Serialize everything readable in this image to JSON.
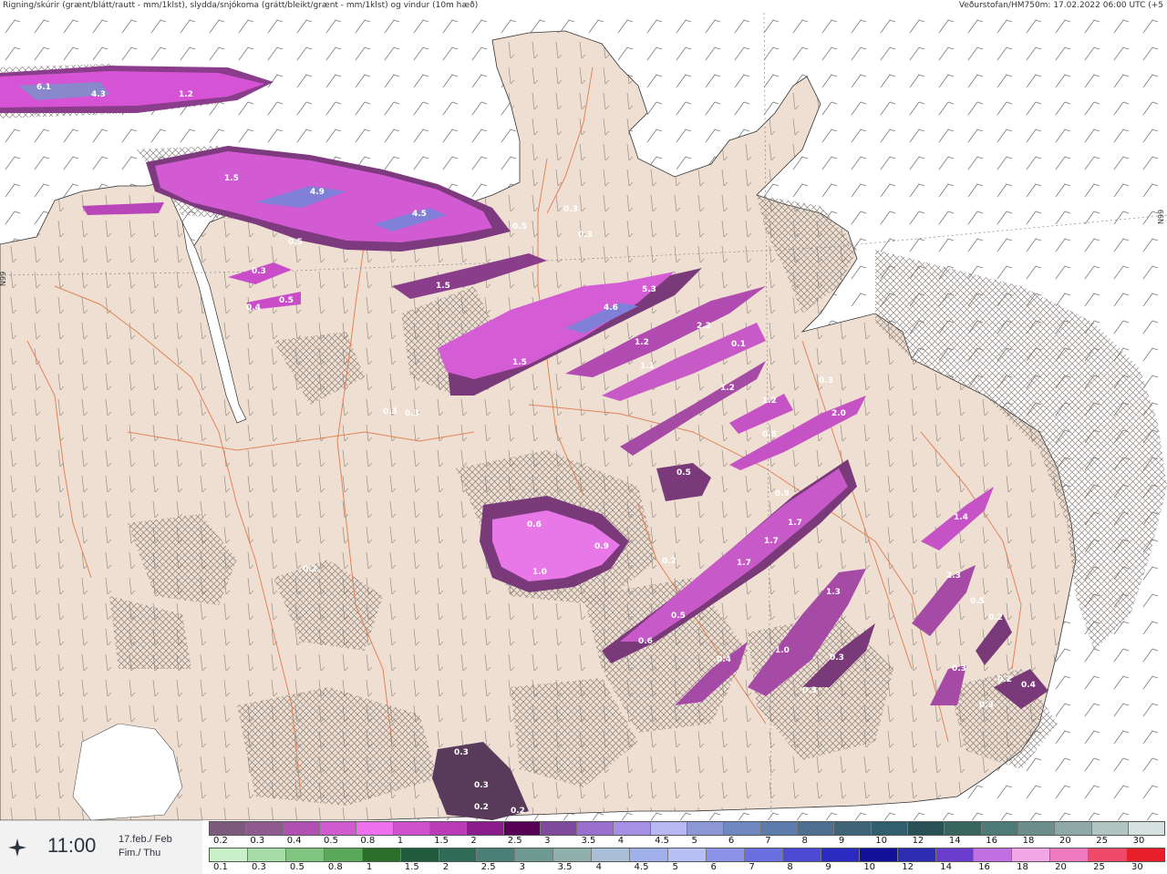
{
  "header": {
    "legend_text": "Rigning/skúrir (grænt/blátt/rautt - mm/1klst), slydda/snjókoma (grátt/bleikt/grænt - mm/1klst) og vindur (10m hæð)",
    "model_text": "Veðurstofan/HM750m: 17.02.2022 06:00 UTC (+5"
  },
  "map": {
    "graticule_labels": [
      "N99",
      "N99"
    ],
    "precip_labels": [
      "6.1",
      "4.3",
      "1.2",
      "1.5",
      "4.9",
      "4.5",
      "0.5",
      "0.3",
      "0.3",
      "0.5",
      "0.3",
      "0.5",
      "0.4",
      "1.5",
      "4.6",
      "5.3",
      "2.2",
      "1.2",
      "1.1",
      "0.1",
      "1.5",
      "1.2",
      "1.2",
      "0.8",
      "0.3",
      "2.0",
      "0.3",
      "0.3",
      "0.5",
      "0.9",
      "1.7",
      "1.7",
      "0.6",
      "0.9",
      "1.0",
      "0.2",
      "1.7",
      "1.3",
      "0.5",
      "0.6",
      "0.4",
      "1.0",
      "0.3",
      "0.3",
      "0.2",
      "1.4",
      "2.3",
      "0.5",
      "0.2",
      "0.3",
      "0.4",
      "0.2",
      "0.3",
      "0.3",
      "0.2",
      "0.3",
      "0.3",
      "0.2",
      "0.2"
    ]
  },
  "timebox": {
    "icon": "compass-star-icon",
    "time": "11:00",
    "date_line1": "17.feb./ Feb",
    "date_line2": "Fim./ Thu"
  },
  "scale_snow": {
    "labels": [
      "0.2",
      "0.3",
      "0.4",
      "0.5",
      "0.8",
      "1",
      "1.5",
      "2",
      "2.5",
      "3",
      "3.5",
      "4",
      "4.5",
      "5",
      "6",
      "7",
      "8",
      "9",
      "10",
      "12",
      "14",
      "16",
      "18",
      "20",
      "25",
      "30"
    ],
    "colors": [
      "#7b5a7b",
      "#8f5b8f",
      "#b24fb2",
      "#d05ad0",
      "#ef70ef",
      "#ce52ce",
      "#b83bb8",
      "#8c1c8c",
      "#550055",
      "#7f4a9b",
      "#9a6fd0",
      "#a590e6",
      "#b8b8f5",
      "#8c98d6",
      "#6e88c2",
      "#5e7cab",
      "#4e6f8f",
      "#3f6478",
      "#2f5e6c",
      "#285055",
      "#3a6660",
      "#4e7a78",
      "#6a8f8c",
      "#8ea9a7",
      "#b0c4c2",
      "#d6e2e0"
    ]
  },
  "scale_rain": {
    "labels": [
      "0.1",
      "0.3",
      "0.5",
      "0.8",
      "1",
      "1.5",
      "2",
      "2.5",
      "3",
      "3.5",
      "4",
      "4.5",
      "5",
      "6",
      "7",
      "8",
      "9",
      "10",
      "12",
      "14",
      "16",
      "18",
      "20",
      "25",
      "30"
    ],
    "colors": [
      "#c9f0c9",
      "#a6dca6",
      "#7fc47f",
      "#5aa85a",
      "#2a6e2a",
      "#1f5b3a",
      "#2f6b57",
      "#4a7f77",
      "#6e9a92",
      "#8fb0ab",
      "#a9bfd8",
      "#9fb0ea",
      "#b6c0f5",
      "#8a93e8",
      "#6a6fdf",
      "#4a4ad4",
      "#2a2ac0",
      "#10109a",
      "#2d2db4",
      "#6a3ccc",
      "#c070e0",
      "#f3a6e6",
      "#f07ac0",
      "#f04a6a",
      "#e81e2a"
    ]
  }
}
